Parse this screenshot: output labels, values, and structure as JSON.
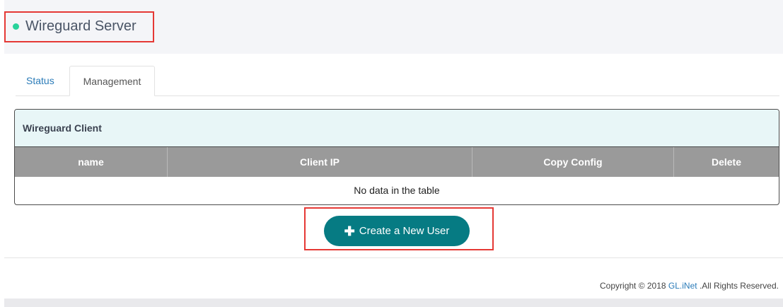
{
  "header": {
    "title": "Wireguard Server",
    "status_color": "#29d39b"
  },
  "tabs": [
    {
      "label": "Status",
      "active": false
    },
    {
      "label": "Management",
      "active": true
    }
  ],
  "client_panel": {
    "title": "Wireguard Client",
    "columns": [
      "name",
      "Client IP",
      "Copy Config",
      "Delete"
    ],
    "rows": [],
    "empty_text": "No data in the table"
  },
  "create_button": {
    "icon": "plus-icon",
    "label": "Create a New User",
    "color": "#067b83"
  },
  "footer": {
    "prefix": "Copyright © 2018 ",
    "brand": "GL.iNet",
    "suffix": " .All Rights Reserved."
  }
}
